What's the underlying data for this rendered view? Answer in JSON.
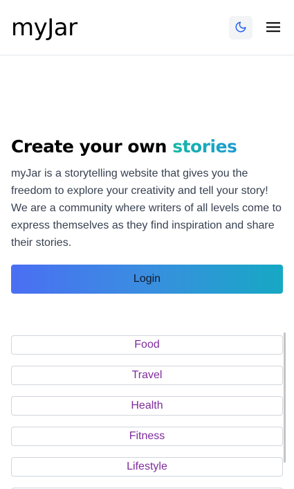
{
  "header": {
    "logo": "myJar",
    "theme_toggle_icon": "moon-icon",
    "menu_icon": "hamburger-menu-icon"
  },
  "hero": {
    "title_prefix": "Create your own ",
    "title_accent": "stories",
    "description": "myJar is a storytelling website that gives you the freedom to explore your creativity and tell your story! We are a community where writers of all levels come to express themselves as they find inspiration and share their stories.",
    "login_label": "Login"
  },
  "categories": [
    "Food",
    "Travel",
    "Health",
    "Fitness",
    "Lifestyle",
    ""
  ],
  "colors": {
    "accent_gradient_start": "#14b8a6",
    "accent_gradient_end": "#1d9bd1",
    "button_gradient_start": "#4a6ff3",
    "button_gradient_end": "#16a8c4",
    "category_text": "#7e2b9c"
  }
}
